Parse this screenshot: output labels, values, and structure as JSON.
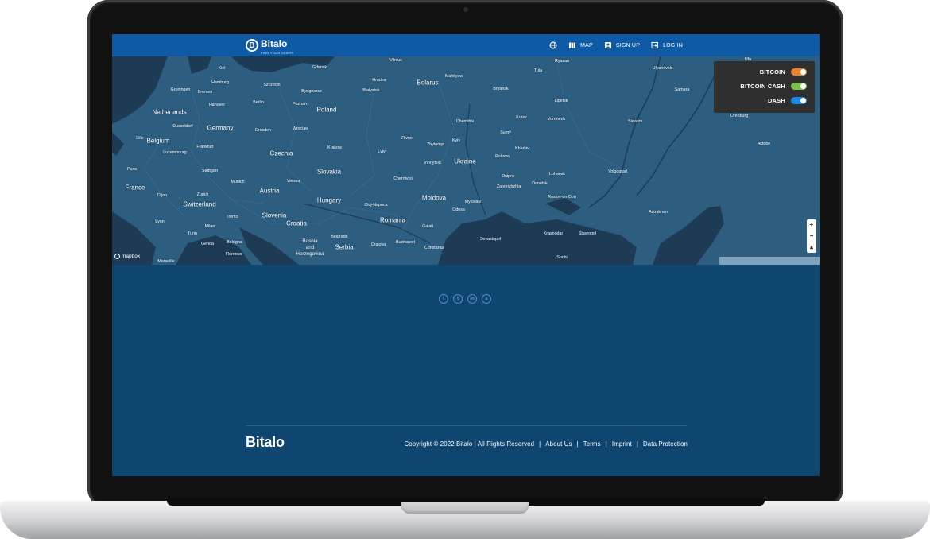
{
  "header": {
    "logo_text": "Bitalo",
    "logo_tagline": "FIND YOUR SEARS",
    "nav": [
      {
        "icon": "globe-icon",
        "label": ""
      },
      {
        "icon": "map-icon",
        "label": "MAP"
      },
      {
        "icon": "user-icon",
        "label": "SIGN UP"
      },
      {
        "icon": "login-icon",
        "label": "LOG IN"
      }
    ]
  },
  "legend": {
    "items": [
      {
        "label": "BITCOIN",
        "color": "#e8822b",
        "enabled": true
      },
      {
        "label": "BITCOIN CASH",
        "color": "#7cc04b",
        "enabled": true
      },
      {
        "label": "DASH",
        "color": "#1c87e0",
        "enabled": true
      }
    ]
  },
  "map": {
    "attribution": "mapbox",
    "zoom_in": "+",
    "zoom_out": "−",
    "compass": "▴",
    "countries": [
      "Netherlands",
      "Germany",
      "Belgium",
      "Poland",
      "Belarus",
      "Czechia",
      "Ukraine",
      "France",
      "Austria",
      "Slovakia",
      "Switzerland",
      "Hungary",
      "Moldova",
      "Slovenia",
      "Croatia",
      "Romania",
      "Bosnia and Herzegovina",
      "Serbia"
    ],
    "cities": [
      "Kiel",
      "Gdansk",
      "Vilnius",
      "Ryazan",
      "Tula",
      "Ulyanovsk",
      "Ufa",
      "Hamburg",
      "Szczecin",
      "Hrodna",
      "Mahilyow",
      "Groningen",
      "Bremen",
      "Bydgoszcz",
      "Bialystok",
      "Bryansk",
      "Samara",
      "Hanover",
      "Berlin",
      "Poznan",
      "Lipetsk",
      "Kursk",
      "Voronezh",
      "Orenburg",
      "Dusseldorf",
      "Dresden",
      "Wroclaw",
      "Chernihiv",
      "Sumy",
      "Saratov",
      "Lille",
      "Frankfurt",
      "Luxembourg",
      "Rivne",
      "Zhytomyr",
      "Kyiv",
      "Kharkiv",
      "Krakow",
      "Lviv",
      "Aktobe",
      "Paris",
      "Stuttgart",
      "Vinnytsia",
      "Poltava",
      "Munich",
      "Vienna",
      "Dnipro",
      "Luhansk",
      "Volgograd",
      "Zaporizhzhia",
      "Donetsk",
      "Dijon",
      "Zurich",
      "Chernivtsi",
      "Cluj-Napoca",
      "Rostov-on-Don",
      "Odesa",
      "Mykolaiv",
      "Astrakhan",
      "Lyon",
      "Trento",
      "Milan",
      "Turin",
      "Bologna",
      "Genoa",
      "Florence",
      "Marseille",
      "Galati",
      "Belgrade",
      "Bucharest",
      "Craiova",
      "Constanta",
      "Sevastopol",
      "Krasnodar",
      "Stavropol",
      "Sochi"
    ]
  },
  "social": [
    {
      "icon": "facebook-icon",
      "glyph": "f"
    },
    {
      "icon": "twitter-icon",
      "glyph": "t"
    },
    {
      "icon": "linkedin-icon",
      "glyph": "in"
    },
    {
      "icon": "skype-icon",
      "glyph": "s"
    }
  ],
  "footer": {
    "logo": "Bitalo",
    "copyright": "Copyright © 2022 Bitalo | All Rights Reserved",
    "links": [
      "About Us",
      "Terms",
      "Imprint",
      "Data Protection"
    ],
    "separator": "|"
  },
  "colors": {
    "header_bg": "#0f5aa4",
    "map_land": "#2d5e80",
    "map_water": "#1d3b55",
    "page_bg": "#0f4670"
  }
}
